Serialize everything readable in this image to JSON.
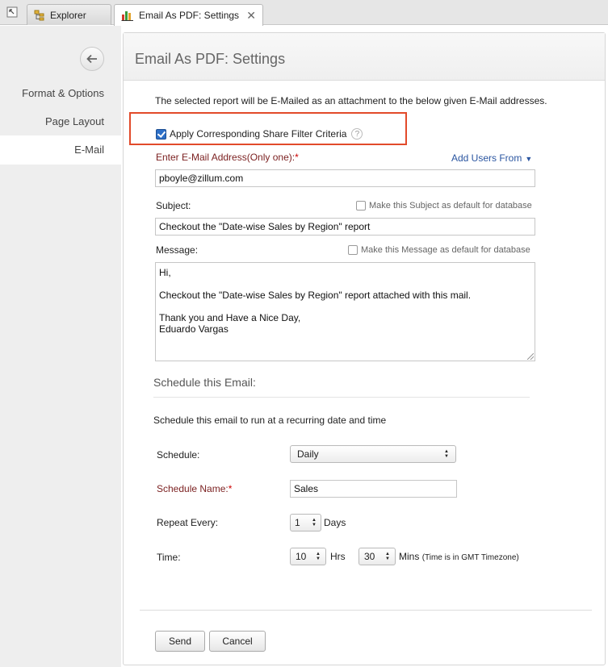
{
  "tabs": {
    "explorer_label": "Explorer",
    "active_label": "Email As PDF: Settings",
    "close_glyph": "✕"
  },
  "sidebar": {
    "items": [
      {
        "label": "Format & Options"
      },
      {
        "label": "Page Layout"
      },
      {
        "label": "E-Mail",
        "active": true
      }
    ]
  },
  "panel": {
    "title": "Email As PDF: Settings",
    "intro": "The selected report will be E-Mailed as an attachment to the below given E-Mail addresses.",
    "apply_filter_label": "Apply Corresponding Share Filter Criteria",
    "apply_filter_checked": true,
    "help_glyph": "?",
    "email": {
      "label": "Enter E-Mail Address(Only one):",
      "required_mark": "*",
      "add_users_label": "Add Users From",
      "value": "pboyle@zillum.com"
    },
    "subject": {
      "label": "Subject:",
      "default_label": "Make this Subject as default for database",
      "value": "Checkout the \"Date-wise Sales by Region\" report"
    },
    "message": {
      "label": "Message:",
      "default_label": "Make this Message as default for database",
      "line1": "Hi,",
      "line2": "Checkout the \"Date-wise Sales by Region\" report attached with this mail.",
      "line3": "Thank you and Have a Nice Day,",
      "line4": "Eduardo Vargas"
    },
    "schedule": {
      "title": "Schedule this Email:",
      "description": "Schedule this email to run at a recurring date and time",
      "schedule_label": "Schedule:",
      "schedule_value": "Daily",
      "name_label": "Schedule Name:",
      "name_required_mark": "*",
      "name_value": "Sales",
      "repeat_label": "Repeat Every:",
      "repeat_value": "1",
      "repeat_unit": "Days",
      "time_label": "Time:",
      "hours_value": "10",
      "hours_unit": "Hrs",
      "minutes_value": "30",
      "minutes_unit": "Mins",
      "timezone_note": "(Time is in GMT Timezone)"
    },
    "buttons": {
      "send": "Send",
      "cancel": "Cancel"
    }
  },
  "colors": {
    "highlight_border": "#e24a2a",
    "required_label": "#7a1f1f",
    "link": "#2a55a0"
  }
}
